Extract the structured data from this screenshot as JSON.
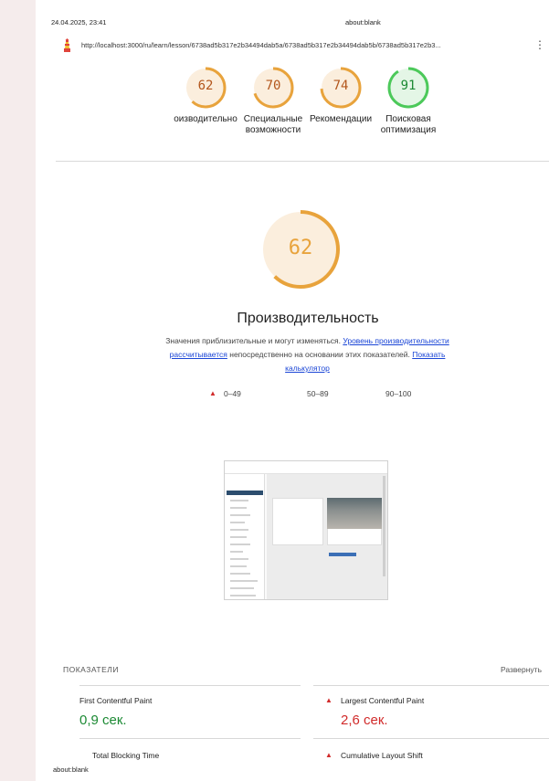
{
  "print_header": {
    "datetime": "24.04.2025, 23:41",
    "title": "about:blank"
  },
  "browser": {
    "url": "http://localhost:3000/ru/learn/lesson/6738ad5b317e2b34494dab5a/6738ad5b317e2b34494dab5b/6738ad5b317e2b3...",
    "menu_icon": "kebab-menu-icon"
  },
  "gauges": [
    {
      "score": "62",
      "value": 62,
      "label_lines": [
        "оизводительно"
      ],
      "color": "#e8a33c",
      "track": "#fbeedd",
      "text_color": "#b3561c"
    },
    {
      "score": "70",
      "value": 70,
      "label_lines": [
        "Специальные",
        "возможности"
      ],
      "color": "#e8a33c",
      "track": "#fbeedd",
      "text_color": "#b3561c"
    },
    {
      "score": "74",
      "value": 74,
      "label_lines": [
        "Рекомендации"
      ],
      "color": "#e8a33c",
      "track": "#fbeedd",
      "text_color": "#b3561c"
    },
    {
      "score": "91",
      "value": 91,
      "label_lines": [
        "Поисковая",
        "оптимизация"
      ],
      "color": "#4cc95a",
      "track": "#e4f6e6",
      "text_color": "#1c8a34"
    }
  ],
  "category": {
    "score": "62",
    "value": 62,
    "title": "Производительность",
    "desc_before": "Значения приблизительные и могут изменяться. ",
    "desc_link1": "Уровень производительности рассчитывается",
    "desc_middle": " непосредственно на основании этих показателей. ",
    "desc_link2": "Показать калькулятор"
  },
  "legend": {
    "fail_range": "0–49",
    "average_range": "50–89",
    "pass_range": "90–100"
  },
  "metrics": {
    "heading": "ПОКАЗАТЕЛИ",
    "expand_label": "Развернуть",
    "items": [
      {
        "name": "First Contentful Paint",
        "value": "0,9 сек.",
        "status": "pass"
      },
      {
        "name": "Largest Contentful Paint",
        "value": "2,6 сек.",
        "status": "fail"
      },
      {
        "name": "Total Blocking Time",
        "value": "",
        "status": "pass"
      },
      {
        "name": "Cumulative Layout Shift",
        "value": "",
        "status": "fail"
      }
    ]
  },
  "colors": {
    "average": "#e8a33c",
    "pass": "#1c8a34",
    "fail": "#d12b2b",
    "link": "#1a45d6"
  },
  "footer": {
    "url": "about:blank"
  }
}
